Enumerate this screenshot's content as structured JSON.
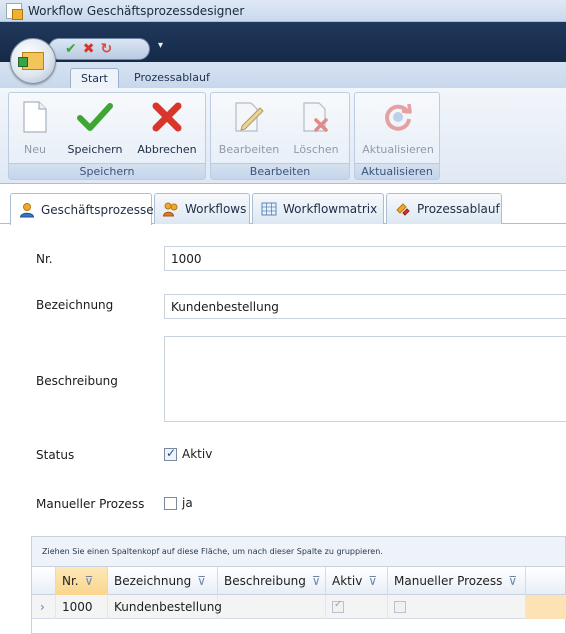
{
  "window": {
    "title": "Workflow Geschäftsprozessdesigner"
  },
  "ribbon": {
    "tabs": [
      {
        "label": "Start",
        "active": true
      },
      {
        "label": "Prozessablauf",
        "active": false
      }
    ],
    "groups": [
      {
        "label": "Speichern",
        "buttons": [
          {
            "label": "Neu",
            "icon": "document-icon",
            "enabled": false
          },
          {
            "label": "Speichern",
            "icon": "checkmark-icon",
            "enabled": true
          },
          {
            "label": "Abbrechen",
            "icon": "cross-icon",
            "enabled": true
          }
        ]
      },
      {
        "label": "Bearbeiten",
        "buttons": [
          {
            "label": "Bearbeiten",
            "icon": "edit-document-icon",
            "enabled": false
          },
          {
            "label": "Löschen",
            "icon": "delete-document-icon",
            "enabled": false
          }
        ]
      },
      {
        "label": "Aktualisieren",
        "buttons": [
          {
            "label": "Aktualisieren",
            "icon": "refresh-icon",
            "enabled": false
          }
        ]
      }
    ]
  },
  "main_tabs": [
    {
      "label": "Geschäftsprozesse",
      "icon": "user-icon",
      "active": true
    },
    {
      "label": "Workflows",
      "icon": "users-icon",
      "active": false
    },
    {
      "label": "Workflowmatrix",
      "icon": "grid-icon",
      "active": false
    },
    {
      "label": "Prozessablauf",
      "icon": "process-icon",
      "active": false
    }
  ],
  "form": {
    "nr_label": "Nr.",
    "nr_value": "1000",
    "bezeichnung_label": "Bezeichnung",
    "bezeichnung_value": "Kundenbestellung",
    "beschreibung_label": "Beschreibung",
    "beschreibung_value": "",
    "status_label": "Status",
    "status_checkbox_label": "Aktiv",
    "status_checked": true,
    "manuell_label": "Manueller Prozess",
    "manuell_checkbox_label": "ja",
    "manuell_checked": false
  },
  "grid": {
    "group_hint": "Ziehen Sie einen Spaltenkopf auf diese Fläche, um nach dieser Spalte zu gruppieren.",
    "columns": [
      "Nr.",
      "Bezeichnung",
      "Beschreibung",
      "Aktiv",
      "Manueller Prozess"
    ],
    "rows": [
      {
        "nr": "1000",
        "bezeichnung": "Kundenbestellung",
        "beschreibung": "",
        "aktiv": true,
        "manuell": false
      }
    ]
  },
  "colors": {
    "accent_green": "#3fa534",
    "accent_red": "#d9362b",
    "sorted_header": "#f9d58d",
    "ribbon_dark": "#162a48"
  }
}
